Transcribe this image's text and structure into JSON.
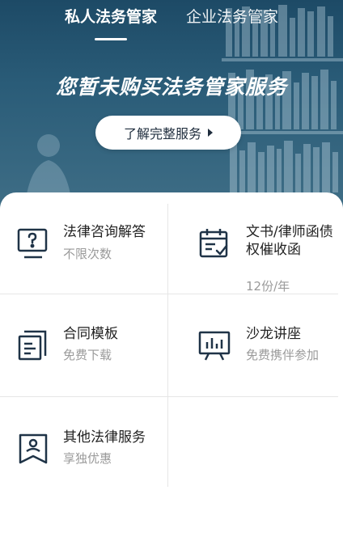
{
  "tabs": [
    {
      "label": "私人法务管家",
      "active": true
    },
    {
      "label": "企业法务管家",
      "active": false
    }
  ],
  "hero": {
    "headline": "您暂未购买法务管家服务",
    "cta_label": "了解完整服务"
  },
  "services": [
    {
      "title": "法律咨询解答",
      "subtitle": "不限次数",
      "icon": "question-screen-icon"
    },
    {
      "title": "文书/律师函债权催收函",
      "subtitle": "12份/年",
      "icon": "calendar-check-icon"
    },
    {
      "title": "合同模板",
      "subtitle": "免费下载",
      "icon": "document-stack-icon"
    },
    {
      "title": "沙龙讲座",
      "subtitle": "免费携伴参加",
      "icon": "presentation-board-icon"
    },
    {
      "title": "其他法律服务",
      "subtitle": "享独优惠",
      "icon": "person-bookmark-icon"
    }
  ],
  "colors": {
    "hero_bg": "#2a5c78",
    "icon_stroke": "#1f3347",
    "title_text": "#222222",
    "subtitle_text": "#9a9a9a"
  }
}
